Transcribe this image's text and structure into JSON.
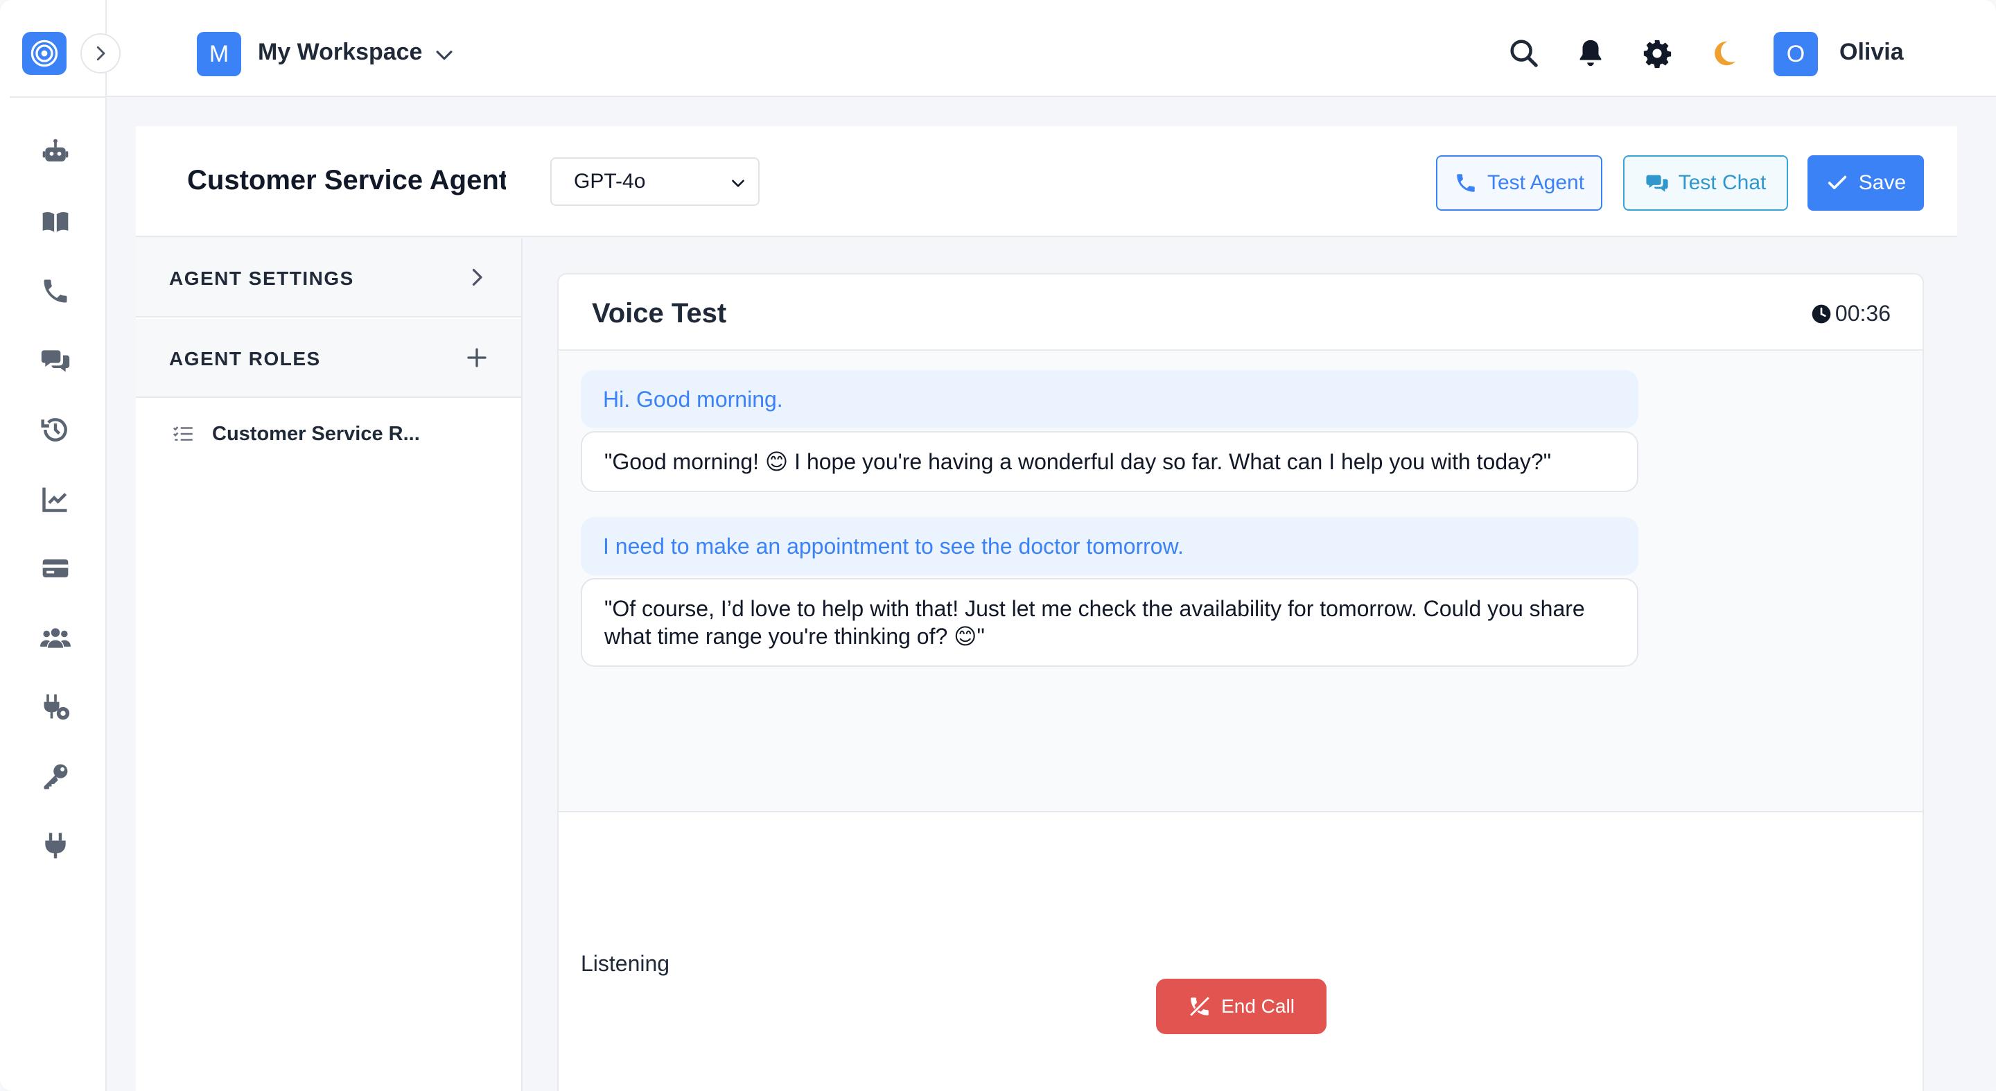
{
  "workspace": {
    "avatar_letter": "M",
    "name": "My Workspace"
  },
  "user": {
    "avatar_letter": "O",
    "name": "Olivia"
  },
  "colors": {
    "accent": "#3b82f6",
    "danger": "#e25450",
    "moon": "#f0a030"
  },
  "rail": {
    "icons": [
      "robot-icon",
      "book-icon",
      "phone-icon",
      "chat-icon",
      "history-icon",
      "chart-icon",
      "credit-card-icon",
      "users-icon",
      "plug-settings-icon",
      "key-icon",
      "plug-icon"
    ]
  },
  "agent": {
    "title": "Customer Service Agent",
    "model": "GPT-4o",
    "buttons": {
      "test_agent": "Test Agent",
      "test_chat": "Test Chat",
      "save": "Save"
    }
  },
  "settings": {
    "agent_settings_label": "AGENT SETTINGS",
    "agent_roles_label": "AGENT ROLES",
    "roles": [
      "Customer Service R..."
    ]
  },
  "voice_test": {
    "title": "Voice Test",
    "timer": "00:36",
    "messages": [
      {
        "role": "user",
        "text": "Hi. Good morning."
      },
      {
        "role": "agent",
        "text": "\"Good morning! 😊 I hope you're having a wonderful day so far. What can I help you with today?\""
      },
      {
        "role": "user",
        "text": "I need to make an appointment to see the doctor tomorrow."
      },
      {
        "role": "agent",
        "text": "\"Of course, I’d love to help with that! Just let me check the availability for tomorrow. Could you share what time range you're thinking of? 😊\""
      }
    ],
    "status": "Listening",
    "end_call": "End Call"
  }
}
